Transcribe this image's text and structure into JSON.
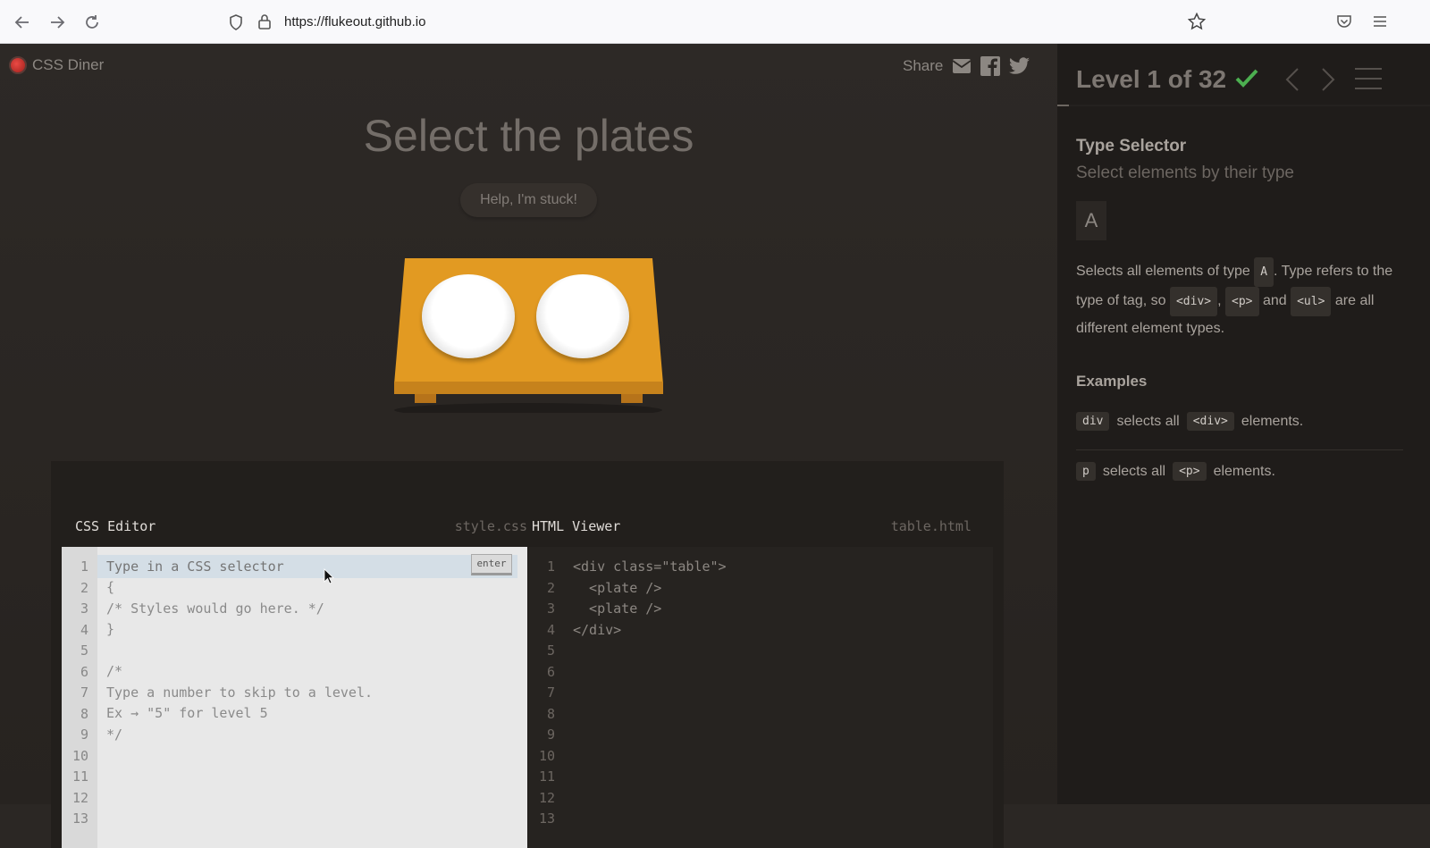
{
  "browser": {
    "url": "https://flukeout.github.io"
  },
  "app": {
    "logo_text": "CSS Diner",
    "share_label": "Share"
  },
  "level": {
    "instruction": "Select the plates",
    "help_button": "Help, I'm stuck!",
    "indicator": "Level 1 of 32",
    "progress_fraction": 0.031
  },
  "editor": {
    "css_title": "CSS Editor",
    "css_file": "style.css",
    "html_title": "HTML Viewer",
    "html_file": "table.html",
    "enter_button": "enter",
    "input_placeholder": "Type in a CSS selector",
    "css_lines": [
      "{",
      "/* Styles would go here. */",
      "}",
      "",
      "/*",
      "Type a number to skip to a level.",
      "Ex → \"5\" for level 5",
      "*/",
      "",
      "",
      "",
      ""
    ],
    "html_lines": [
      "<div class=\"table\">",
      "  <plate />",
      "  <plate />",
      "</div>",
      "",
      "",
      "",
      "",
      "",
      "",
      "",
      "",
      ""
    ],
    "line_numbers": [
      "1",
      "2",
      "3",
      "4",
      "5",
      "6",
      "7",
      "8",
      "9",
      "10",
      "11",
      "12",
      "13"
    ]
  },
  "sidebar": {
    "selector_name": "Type Selector",
    "selector_subtitle": "Select elements by their type",
    "syntax": "A",
    "desc_1": "Selects all elements of type",
    "desc_chip_a": "A",
    "desc_2": ". Type refers to the type of tag, so",
    "chip_div": "<div>",
    "comma": ",",
    "chip_p": "<p>",
    "and": "and",
    "chip_ul": "<ul>",
    "desc_3": "are all different element types.",
    "examples_title": "Examples",
    "example_1": {
      "code": "div",
      "mid": "selects all",
      "tag": "<div>",
      "end": "elements."
    },
    "example_2": {
      "code": "p",
      "mid": "selects all",
      "tag": "<p>",
      "end": "elements."
    }
  },
  "colors": {
    "table": "#e29a22",
    "check": "#4caf50",
    "background": "#2b2724",
    "sidebar": "#1f1c1a"
  }
}
